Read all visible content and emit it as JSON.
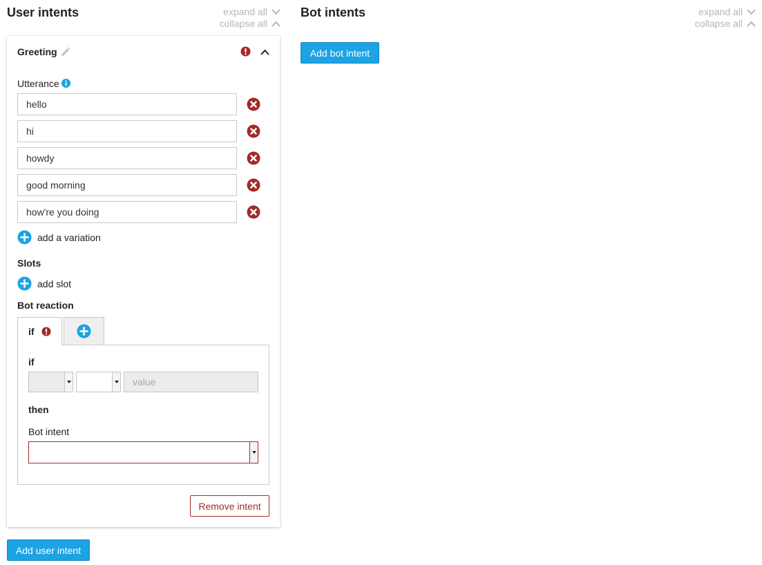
{
  "colors": {
    "accent": "#1ca3e3",
    "danger": "#a32a2a",
    "muted": "#b5b5b5"
  },
  "user_panel": {
    "title": "User intents",
    "expand_all": "expand all",
    "collapse_all": "collapse all",
    "add_button": "Add user intent"
  },
  "bot_panel": {
    "title": "Bot intents",
    "expand_all": "expand all",
    "collapse_all": "collapse all",
    "add_button": "Add bot intent"
  },
  "intent": {
    "name": "Greeting",
    "utterance_label": "Utterance",
    "utterances": [
      "hello",
      "hi",
      "howdy",
      "good morning",
      "how're you doing"
    ],
    "add_variation": "add a variation",
    "slots_label": "Slots",
    "add_slot": "add slot",
    "bot_reaction_label": "Bot reaction",
    "tab_label": "if",
    "condition": {
      "if_label": "if",
      "value_placeholder": "value",
      "then_label": "then",
      "bot_intent_label": "Bot intent",
      "bot_intent_value": ""
    },
    "remove_button": "Remove intent"
  }
}
